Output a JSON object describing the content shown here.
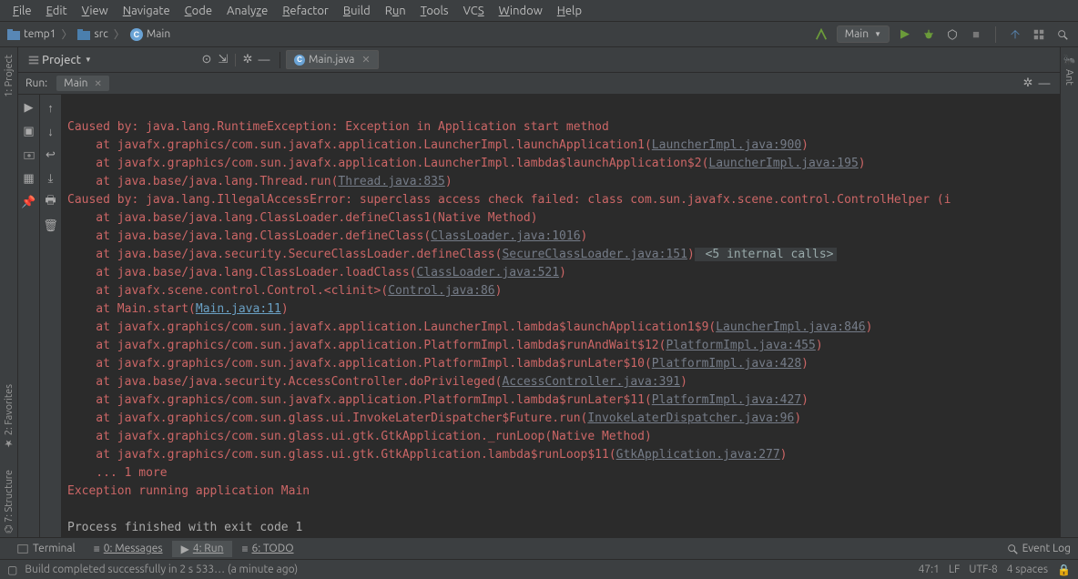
{
  "menu": [
    "File",
    "Edit",
    "View",
    "Navigate",
    "Code",
    "Analyze",
    "Refactor",
    "Build",
    "Run",
    "Tools",
    "VCS",
    "Window",
    "Help"
  ],
  "breadcrumb": {
    "root": "temp1",
    "src": "src",
    "cls": "Main"
  },
  "run_config": {
    "label": "Main"
  },
  "project_tool": {
    "title": "Project"
  },
  "editor_tab": {
    "label": "Main.java"
  },
  "run_header": {
    "label": "Run:",
    "tab": "Main"
  },
  "left_vertical": {
    "project": "1: Project"
  },
  "right_vertical": {
    "ant": "Ant"
  },
  "console": {
    "l1": "Caused by: java.lang.RuntimeException: Exception in Application start method",
    "l2": {
      "pre": "    at javafx.graphics/com.sun.javafx.application.LauncherImpl.launchApplication1(",
      "link": "LauncherImpl.java:900",
      "post": ")"
    },
    "l3": {
      "pre": "    at javafx.graphics/com.sun.javafx.application.LauncherImpl.lambda$launchApplication$2(",
      "link": "LauncherImpl.java:195",
      "post": ")"
    },
    "l4": {
      "pre": "    at java.base/java.lang.Thread.run(",
      "link": "Thread.java:835",
      "post": ")"
    },
    "l5": "Caused by: java.lang.IllegalAccessError: superclass access check failed: class com.sun.javafx.scene.control.ControlHelper (i",
    "l6": "    at java.base/java.lang.ClassLoader.defineClass1(Native Method)",
    "l7": {
      "pre": "    at java.base/java.lang.ClassLoader.defineClass(",
      "link": "ClassLoader.java:1016",
      "post": ")"
    },
    "l8": {
      "pre": "    at java.base/java.security.SecureClassLoader.defineClass(",
      "link": "SecureClassLoader.java:151",
      "post": ")",
      "hint": " <5 internal calls>"
    },
    "l9": {
      "pre": "    at java.base/java.lang.ClassLoader.loadClass(",
      "link": "ClassLoader.java:521",
      "post": ")"
    },
    "l10": {
      "pre": "    at javafx.scene.control.Control.<clinit>(",
      "link": "Control.java:86",
      "post": ")"
    },
    "l11": {
      "pre": "    at Main.start(",
      "link": "Main.java:11",
      "post": ")"
    },
    "l12": {
      "pre": "    at javafx.graphics/com.sun.javafx.application.LauncherImpl.lambda$launchApplication1$9(",
      "link": "LauncherImpl.java:846",
      "post": ")"
    },
    "l13": {
      "pre": "    at javafx.graphics/com.sun.javafx.application.PlatformImpl.lambda$runAndWait$12(",
      "link": "PlatformImpl.java:455",
      "post": ")"
    },
    "l14": {
      "pre": "    at javafx.graphics/com.sun.javafx.application.PlatformImpl.lambda$runLater$10(",
      "link": "PlatformImpl.java:428",
      "post": ")"
    },
    "l15": {
      "pre": "    at java.base/java.security.AccessController.doPrivileged(",
      "link": "AccessController.java:391",
      "post": ")"
    },
    "l16": {
      "pre": "    at javafx.graphics/com.sun.javafx.application.PlatformImpl.lambda$runLater$11(",
      "link": "PlatformImpl.java:427",
      "post": ")"
    },
    "l17": {
      "pre": "    at javafx.graphics/com.sun.glass.ui.InvokeLaterDispatcher$Future.run(",
      "link": "InvokeLaterDispatcher.java:96",
      "post": ")"
    },
    "l18": "    at javafx.graphics/com.sun.glass.ui.gtk.GtkApplication._runLoop(Native Method)",
    "l19": {
      "pre": "    at javafx.graphics/com.sun.glass.ui.gtk.GtkApplication.lambda$runLoop$11(",
      "link": "GtkApplication.java:277",
      "post": ")"
    },
    "l20": "    ... 1 more",
    "l21": "Exception running application Main",
    "l22": "",
    "l23": "Process finished with exit code 1"
  },
  "bottom_tabs": {
    "terminal": "Terminal",
    "messages": "0: Messages",
    "run": "4: Run",
    "todo": "6: TODO",
    "event_log": "Event Log"
  },
  "status": {
    "msg": "Build completed successfully in 2 s 533… (a minute ago)",
    "pos": "47:1",
    "lf": "LF",
    "enc": "UTF-8",
    "indent": "4 spaces"
  }
}
